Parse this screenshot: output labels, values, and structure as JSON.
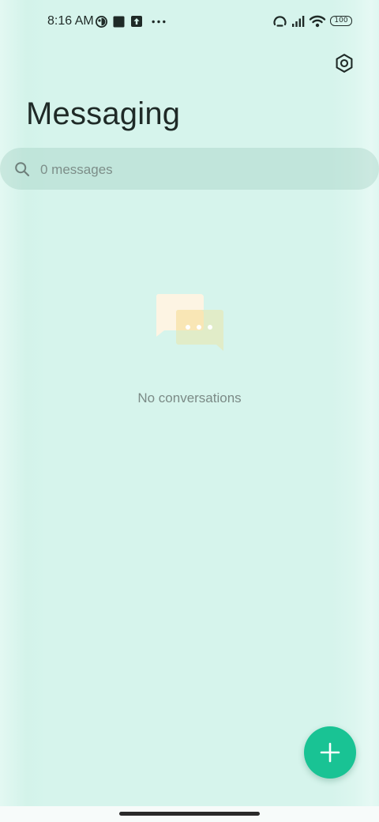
{
  "status_bar": {
    "time": "8:16 AM",
    "battery": "100",
    "icons": [
      "vpn-icon",
      "notification-square-icon",
      "upload-icon",
      "more-dots-icon",
      "hotspot-icon",
      "signal-icon",
      "wifi-icon",
      "battery-icon"
    ]
  },
  "header": {
    "title": "Messaging",
    "settings_icon": "settings-hexagon-icon"
  },
  "search": {
    "placeholder": "0 messages",
    "icon": "search-icon"
  },
  "empty_state": {
    "text": "No conversations",
    "illustration": "chat-bubbles-icon"
  },
  "fab": {
    "icon": "plus-icon",
    "color": "#19c394"
  },
  "colors": {
    "background": "#d6f4ec",
    "accent": "#19c394"
  }
}
